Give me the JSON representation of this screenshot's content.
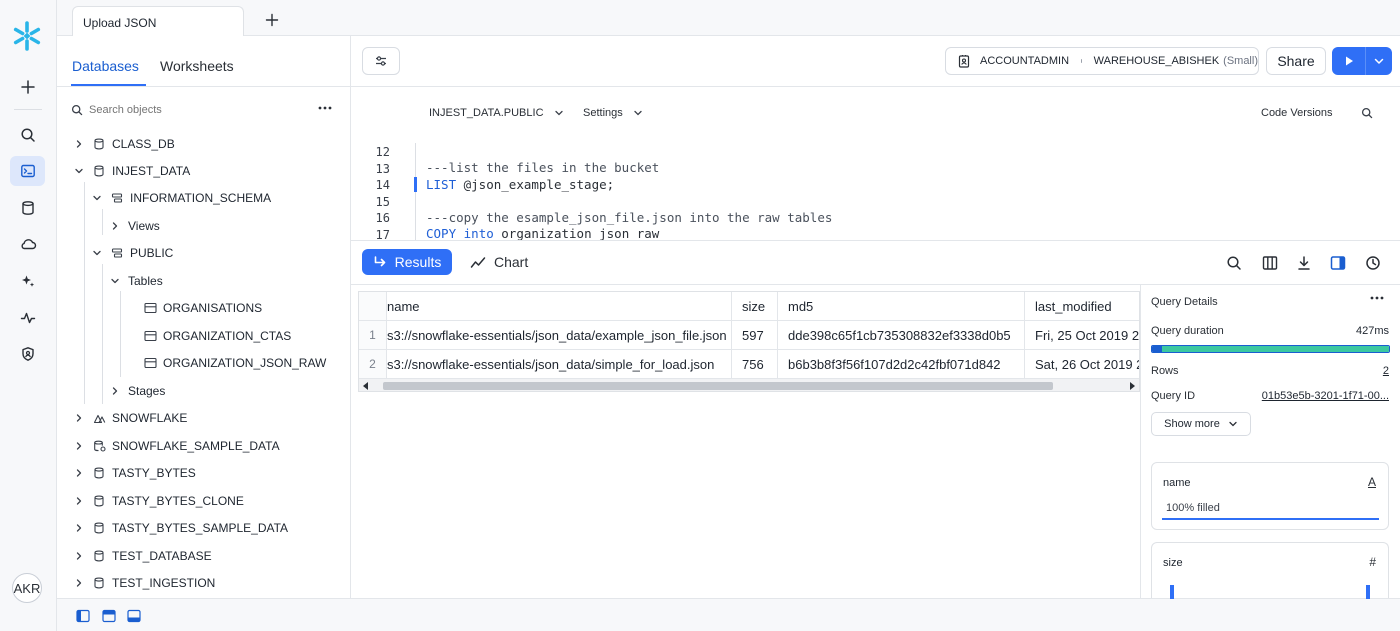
{
  "tab": {
    "title": "Upload JSON"
  },
  "sidebar": {
    "tabs": [
      "Databases",
      "Worksheets"
    ],
    "search_placeholder": "Search objects",
    "tree": [
      "CLASS_DB",
      "INJEST_DATA",
      "INFORMATION_SCHEMA",
      "Views",
      "PUBLIC",
      "Tables",
      "ORGANISATIONS",
      "ORGANIZATION_CTAS",
      "ORGANIZATION_JSON_RAW",
      "Stages",
      "SNOWFLAKE",
      "SNOWFLAKE_SAMPLE_DATA",
      "TASTY_BYTES",
      "TASTY_BYTES_CLONE",
      "TASTY_BYTES_SAMPLE_DATA",
      "TEST_DATABASE",
      "TEST_INGESTION"
    ]
  },
  "user": {
    "initials": "AKR"
  },
  "toolbar": {
    "role": "ACCOUNTADMIN",
    "warehouse": "WAREHOUSE_ABISHEK",
    "warehouse_size": "(Small)",
    "share_label": "Share"
  },
  "editor": {
    "context": "INJEST_DATA.PUBLIC",
    "settings_label": "Settings",
    "code_versions_label": "Code Versions",
    "line_numbers": [
      "12",
      "13",
      "14",
      "15",
      "16",
      "17"
    ],
    "lines": {
      "l13": "---list the files in the bucket",
      "l14_kw": "LIST",
      "l14_rest": " @json_example_stage;",
      "l16": "---copy the esample_json_file.json into the raw tables",
      "l17_kw": "COPY",
      "l17_kw2": "into",
      "l17_rest": "organization_json_raw"
    }
  },
  "results": {
    "tabs": {
      "results": "Results",
      "chart": "Chart"
    },
    "columns": [
      "name",
      "size",
      "md5",
      "last_modified"
    ],
    "rows": [
      {
        "index": "1",
        "name": "s3://snowflake-essentials/json_data/example_json_file.json",
        "size": "597",
        "md5": "dde398c65f1cb735308832ef3338d0b5",
        "last_modified": "Fri, 25 Oct 2019 2"
      },
      {
        "index": "2",
        "name": "s3://snowflake-essentials/json_data/simple_for_load.json",
        "size": "756",
        "md5": "b6b3b8f3f56f107d2d2c42fbf071d842",
        "last_modified": "Sat, 26 Oct 2019 2"
      }
    ]
  },
  "query_details": {
    "title": "Query Details",
    "duration_label": "Query duration",
    "duration_value": "427ms",
    "rows_label": "Rows",
    "rows_value": "2",
    "query_id_label": "Query ID",
    "query_id_value": "01b53e5b-3201-1f71-00...",
    "show_more_label": "Show more",
    "cards": [
      {
        "title": "name",
        "type_glyph": "A",
        "fill_text": "100% filled"
      },
      {
        "title": "size",
        "type_glyph": "#"
      }
    ]
  },
  "colors": {
    "accent": "#2f6ff6",
    "brand": "#29b5e8",
    "duration_bar": "#3cc8a0"
  }
}
